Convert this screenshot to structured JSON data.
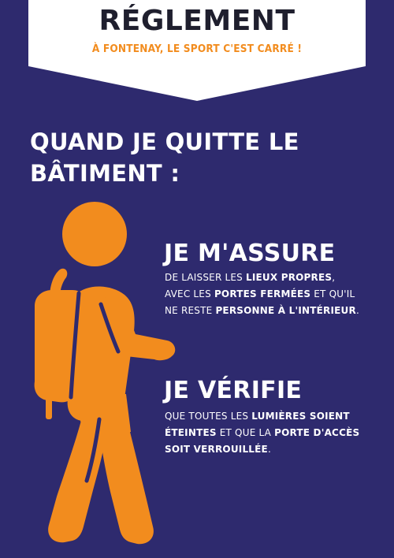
{
  "banner": {
    "title": "RÉGLEMENT",
    "subtitle": "À FONTENAY, LE SPORT C'EST CARRÉ !"
  },
  "heading": {
    "line1": "QUAND JE QUITTE LE",
    "line2": "BÂTIMENT :"
  },
  "assure": {
    "title": "JE M'ASSURE",
    "l1_a": "de laisser les ",
    "l1_b": "lieux propres",
    "l1_c": ",",
    "l2_a": "avec les ",
    "l2_b": "portes fermées",
    "l2_c": " et qu'il",
    "l3_a": "ne reste ",
    "l3_b": "personne à l'intérieur",
    "l3_c": "."
  },
  "verifie": {
    "title": "JE VÉRIFIE",
    "l1_a": "que toutes les ",
    "l1_b": "lumières soient",
    "l2_a": "éteintes",
    "l2_b": " et que la ",
    "l2_c": "porte d'accès",
    "l3_a": "soit verrouillée",
    "l3_b": "."
  },
  "colors": {
    "background": "#2e2a6e",
    "accent": "#f28c1e",
    "banner": "#ffffff",
    "text": "#ffffff"
  },
  "icons": {
    "figure": "walking-person-with-backpack-icon"
  }
}
